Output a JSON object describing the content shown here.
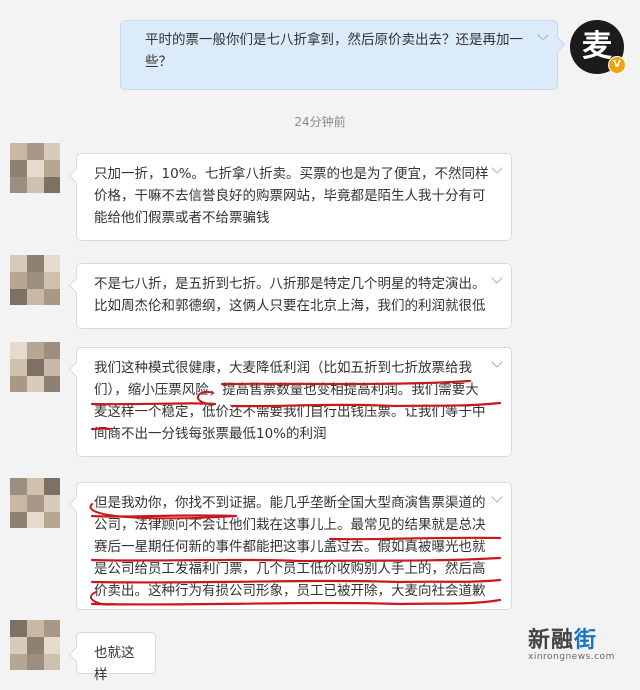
{
  "outgoing": {
    "text_lines": [
      "平时的票一般你们是七八折拿到，然后原价卖出去？还是再加一",
      "些？"
    ],
    "avatar_char": "麦",
    "badge_char": "V"
  },
  "timestamp": "24分钟前",
  "incoming": [
    {
      "lines": [
        "只加一折，10%。七折拿八折卖。买票的也是为了便宜，不然同样",
        "价格，干嘛不去信誉良好的购票网站，毕竟都是陌生人我十分有可",
        "能给他们假票或者不给票骗钱"
      ]
    },
    {
      "lines": [
        "不是七八折，是五折到七折。八折那是特定几个明星的特定演出。",
        "比如周杰伦和郭德纲，这俩人只要在北京上海，我们的利润就很低"
      ]
    },
    {
      "lines": [
        "我们这种模式很健康，大麦降低利润（比如五折到七折放票给我",
        "们），缩小压票风险，提高售票数量也变相提高利润。我们需要大",
        "麦这样一个稳定，低价还不需要我们自行出钱压票。让我们等于中",
        "间商不出一分钱每张票最低10%的利润"
      ]
    },
    {
      "lines": [
        "但是我劝你，你找不到证据。能几乎垄断全国大型商演售票渠道的",
        "公司，法律顾问不会让他们栽在这事儿上。最常见的结果就是总决",
        "赛后一星期任何新的事件都能把这事儿盖过去。假如真被曝光也就",
        "是公司给员工发福利门票，几个员工低价收购别人手上的，然后高",
        "价卖出。这种行为有损公司形象，员工已被开除，大麦向社会道歉"
      ]
    },
    {
      "lines": [
        "也就这样"
      ]
    }
  ],
  "watermark": {
    "name_prefix": "新融",
    "name_suffix": "街",
    "url": "xinrongnews.com"
  },
  "colors": {
    "outgoing_bubble": "#dcebf9",
    "incoming_bubble": "#ffffff",
    "underline": "#c8181e",
    "background": "#f3f3f3"
  }
}
